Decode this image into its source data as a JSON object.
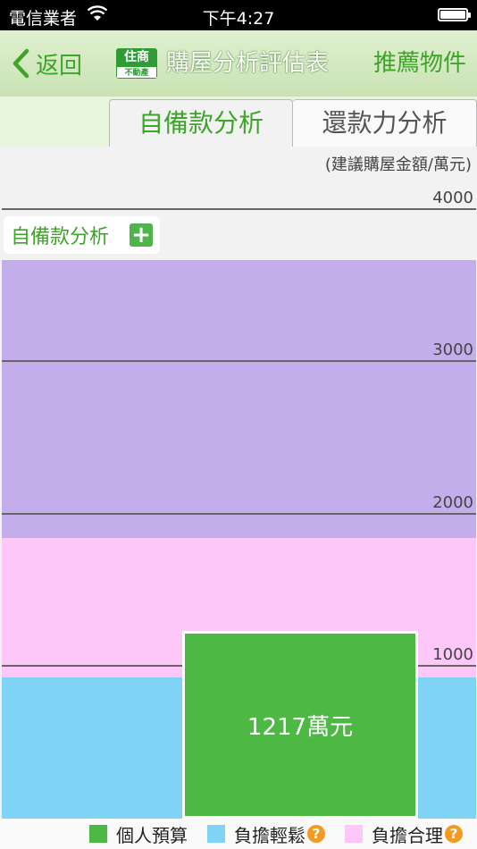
{
  "status_bar": {
    "carrier": "電信業者",
    "time": "下午4:27"
  },
  "nav": {
    "back_label": "返回",
    "logo_top": "住商",
    "logo_bottom": "不動產",
    "title": "購屋分析評估表",
    "right_label": "推薦物件"
  },
  "tabs": [
    {
      "label": "自備款分析",
      "active": true
    },
    {
      "label": "還款力分析",
      "active": false
    }
  ],
  "chart": {
    "unit_label": "(建議購屋金額/萬元)",
    "section_label": "自備款分析",
    "y_ticks": [
      "4000",
      "3000",
      "2000",
      "1000"
    ],
    "budget_value": 1217,
    "budget_label": "1217萬元",
    "colors": {
      "budget": "#4db844",
      "easy": "#7fd3f5",
      "reasonable": "#fdc7f7",
      "heavy": "#c4adeb"
    }
  },
  "legend": [
    {
      "label": "個人預算",
      "color": "#4db844",
      "help": false
    },
    {
      "label": "負擔輕鬆",
      "color": "#7fd3f5",
      "help": true
    },
    {
      "label": "負擔合理",
      "color": "#fdc7f7",
      "help": true
    }
  ]
}
